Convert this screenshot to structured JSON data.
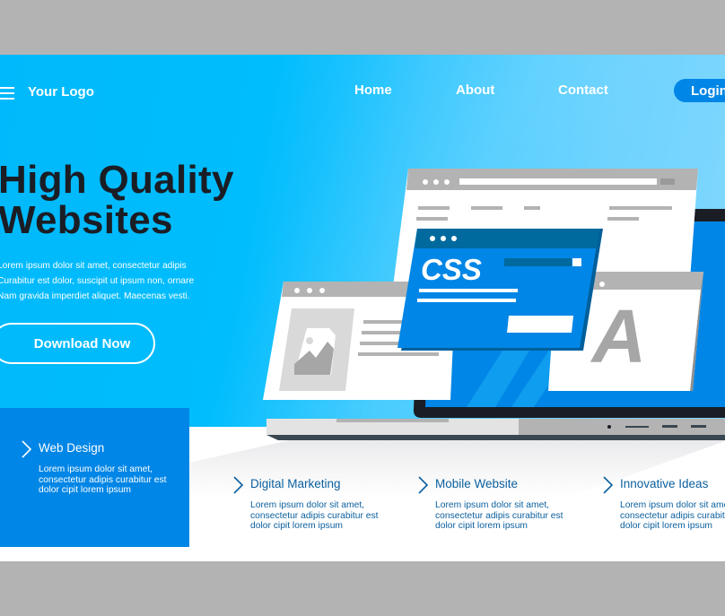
{
  "nav": {
    "menu_icon": "hamburger-menu-icon",
    "logo": "Your Logo",
    "links": [
      "Home",
      "About",
      "Contact"
    ],
    "login_label": "Login"
  },
  "hero": {
    "headline_line1": "High Quality",
    "headline_line2": "Websites",
    "description_lines": [
      "Lorem ipsum dolor sit amet, consectetur adipis",
      "Curabitur est dolor, suscipit ut ipsum non, ornare",
      "Nam gravida imperdiet aliquet. Maecenas vesti."
    ],
    "cta_label": "Download Now"
  },
  "illustration": {
    "css_window_label": "CSS",
    "font_window_letter": "A",
    "image_icon": "image-placeholder-icon"
  },
  "features": [
    {
      "title": "Web Design",
      "description": "Lorem ipsum dolor sit amet, consectetur adipis curabitur est dolor cipit lorem ipsum",
      "active": true
    },
    {
      "title": "Digital Marketing",
      "description": "Lorem ipsum dolor sit amet, consectetur adipis curabitur est dolor cipit lorem ipsum",
      "active": false
    },
    {
      "title": "Mobile Website",
      "description": "Lorem ipsum dolor sit amet, consectetur adipis curabitur est dolor cipit lorem ipsum",
      "active": false
    },
    {
      "title": "Innovative Ideas",
      "description": "Lorem ipsum dolor sit amet, consectetur adipis curabitur est dolor cipit lorem ipsum",
      "active": false
    }
  ],
  "colors": {
    "hero_gradient_start": "#00b9fc",
    "hero_gradient_end": "#82d7fd",
    "accent_blue": "#0086e6",
    "headline": "#1b1d25",
    "feature_text": "#0a5f9e",
    "frame_gray": "#b3b3b3"
  }
}
